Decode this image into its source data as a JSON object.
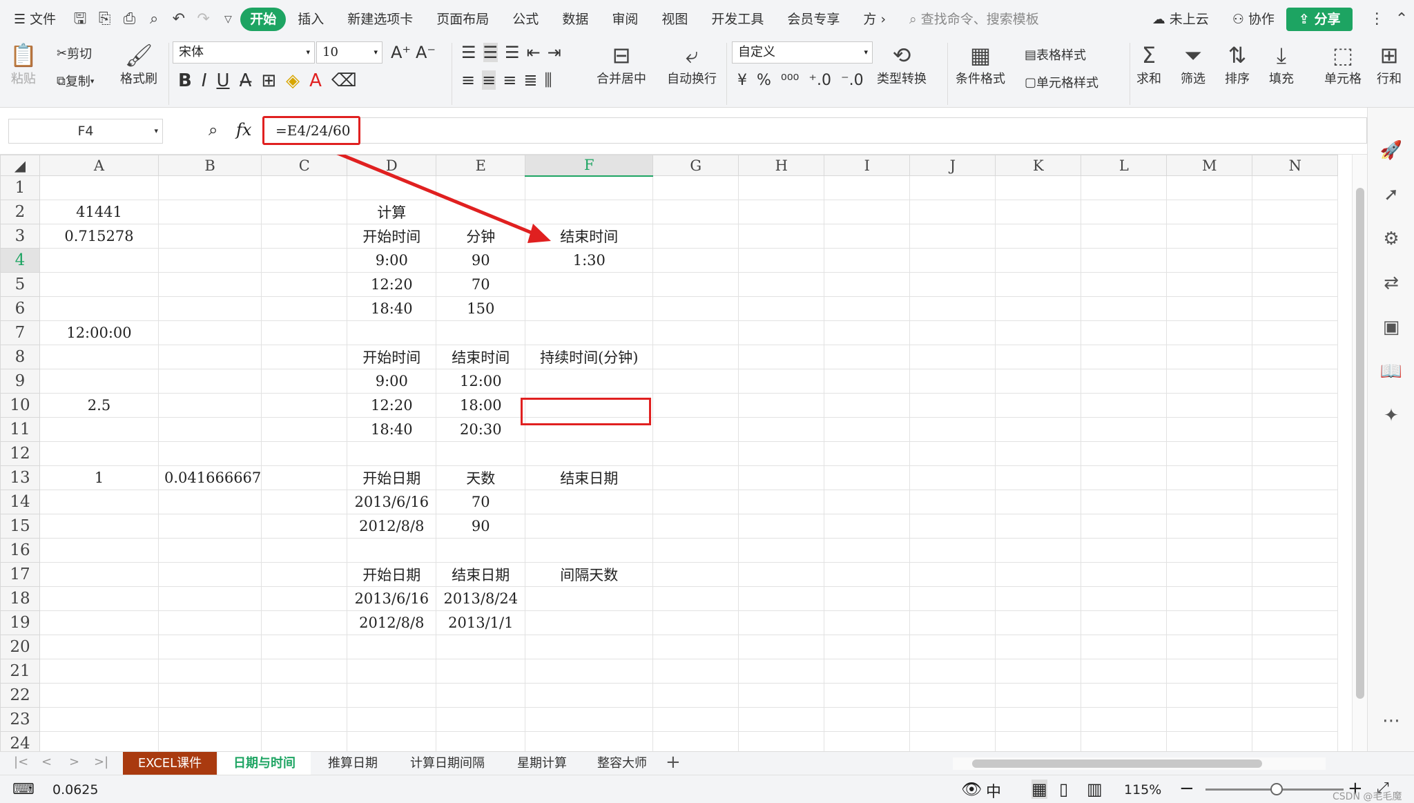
{
  "tabs": {
    "file": "文件",
    "home": "开始",
    "insert": "插入",
    "new_tab": "新建选项卡",
    "layout": "页面布局",
    "formula": "公式",
    "data": "数据",
    "review": "审阅",
    "view": "视图",
    "dev": "开发工具",
    "member": "会员专享",
    "more": "方",
    "search": "查找命令、搜索模板",
    "cloud": "未上云",
    "collab": "协作",
    "share": "分享"
  },
  "ribbon": {
    "paste": "粘贴",
    "cut": "剪切",
    "copy": "复制",
    "format_painter": "格式刷",
    "font": "宋体",
    "size": "10",
    "merge": "合并居中",
    "wrap": "自动换行",
    "numfmt": "自定义",
    "convert": "类型转换",
    "cond": "条件格式",
    "table_style": "表格样式",
    "cell_style": "单元格样式",
    "sum": "求和",
    "filter": "筛选",
    "sort": "排序",
    "fill": "填充",
    "cells": "单元格",
    "rowcol": "行和"
  },
  "namebox": "F4",
  "fx": "fx",
  "formula": "=E4/24/60",
  "columns": [
    "A",
    "B",
    "C",
    "D",
    "E",
    "F",
    "G",
    "H",
    "I",
    "J",
    "K",
    "L",
    "M",
    "N"
  ],
  "rows": [
    [
      "",
      "",
      "",
      "",
      "",
      ""
    ],
    [
      "41441",
      "",
      "",
      "计算",
      "",
      ""
    ],
    [
      "0.715278",
      "",
      "",
      "开始时间",
      "分钟",
      "结束时间"
    ],
    [
      "",
      "",
      "",
      "9:00",
      "90",
      "1:30"
    ],
    [
      "",
      "",
      "",
      "12:20",
      "70",
      ""
    ],
    [
      "",
      "",
      "",
      "18:40",
      "150",
      ""
    ],
    [
      "12:00:00",
      "",
      "",
      "",
      "",
      ""
    ],
    [
      "",
      "",
      "",
      "开始时间",
      "结束时间",
      "持续时间(分钟)"
    ],
    [
      "",
      "",
      "",
      "9:00",
      "12:00",
      ""
    ],
    [
      "2.5",
      "",
      "",
      "12:20",
      "18:00",
      ""
    ],
    [
      "",
      "",
      "",
      "18:40",
      "20:30",
      ""
    ],
    [
      "",
      "",
      "",
      "",
      "",
      ""
    ],
    [
      "1",
      "0.041666667",
      "",
      "开始日期",
      "天数",
      "结束日期"
    ],
    [
      "",
      "",
      "",
      "2013/6/16",
      "70",
      ""
    ],
    [
      "",
      "",
      "",
      "2012/8/8",
      "90",
      ""
    ],
    [
      "",
      "",
      "",
      "",
      "",
      ""
    ],
    [
      "",
      "",
      "",
      "开始日期",
      "结束日期",
      "间隔天数"
    ],
    [
      "",
      "",
      "",
      "2013/6/16",
      "2013/8/24",
      ""
    ],
    [
      "",
      "",
      "",
      "2012/8/8",
      "2013/1/1",
      ""
    ],
    [
      "",
      "",
      "",
      "",
      "",
      ""
    ],
    [
      "",
      "",
      "",
      "",
      "",
      ""
    ],
    [
      "",
      "",
      "",
      "",
      "",
      ""
    ],
    [
      "",
      "",
      "",
      "",
      "",
      ""
    ],
    [
      "",
      "",
      "",
      "",
      "",
      ""
    ]
  ],
  "sheets": [
    "EXCEL课件",
    "日期与时间",
    "推算日期",
    "计算日期间隔",
    "星期计算",
    "整容大师"
  ],
  "status": {
    "value": "0.0625",
    "zoom": "115%",
    "watermark": "CSDN @毛毛魔"
  },
  "colors": {
    "accent": "#1da462",
    "highlight": "#e02020",
    "sheet_red": "#a93a0f"
  }
}
